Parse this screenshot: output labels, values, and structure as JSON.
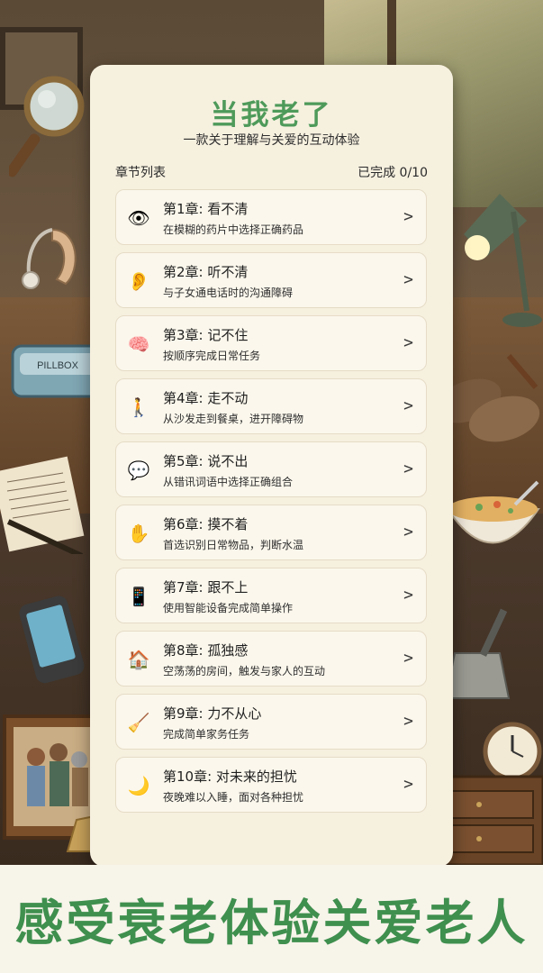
{
  "app": {
    "title": "当我老了",
    "subtitle": "一款关于理解与关爱的互动体验"
  },
  "list": {
    "header": "章节列表",
    "progress": "已完成 0/10"
  },
  "chapters": [
    {
      "title": "第1章: 看不清",
      "desc": "在模糊的药片中选择正确药品",
      "icon": "eye-icon",
      "glyph": "👁",
      "chevron": ">"
    },
    {
      "title": "第2章: 听不清",
      "desc": "与子女通电话时的沟通障碍",
      "icon": "ear-icon",
      "glyph": "👂",
      "chevron": ">"
    },
    {
      "title": "第3章: 记不住",
      "desc": "按顺序完成日常任务",
      "icon": "brain-icon",
      "glyph": "🧠",
      "chevron": ">"
    },
    {
      "title": "第4章: 走不动",
      "desc": "从沙发走到餐桌，进开障碍物",
      "icon": "walking-person-icon",
      "glyph": "🚶",
      "chevron": ">"
    },
    {
      "title": "第5章: 说不出",
      "desc": "从错讯词语中选择正确组合",
      "icon": "speech-bubble-icon",
      "glyph": "💬",
      "chevron": ">"
    },
    {
      "title": "第6章: 摸不着",
      "desc": "首选识别日常物品，判断水温",
      "icon": "hand-icon",
      "glyph": "✋",
      "chevron": ">"
    },
    {
      "title": "第7章: 跟不上",
      "desc": "使用智能设备完成简单操作",
      "icon": "smartphone-icon",
      "glyph": "📱",
      "chevron": ">"
    },
    {
      "title": "第8章: 孤独感",
      "desc": "空荡荡的房间，触发与家人的互动",
      "icon": "house-icon",
      "glyph": "🏠",
      "chevron": ">"
    },
    {
      "title": "第9章: 力不从心",
      "desc": "完成简单家务任务",
      "icon": "broom-icon",
      "glyph": "🧹",
      "chevron": ">"
    },
    {
      "title": "第10章: 对未来的担忧",
      "desc": "夜晚难以入睡，面对各种担忧",
      "icon": "crescent-moon-icon",
      "glyph": "🌙",
      "chevron": ">"
    }
  ],
  "props": {
    "pillbox_label": "PILLBOX"
  },
  "banner": {
    "slogan": "感受衰老体验关爱老人"
  },
  "colors": {
    "accent_green": "#4e9a5a",
    "card_bg": "#f6f0df",
    "item_bg": "#fbf7ec"
  }
}
